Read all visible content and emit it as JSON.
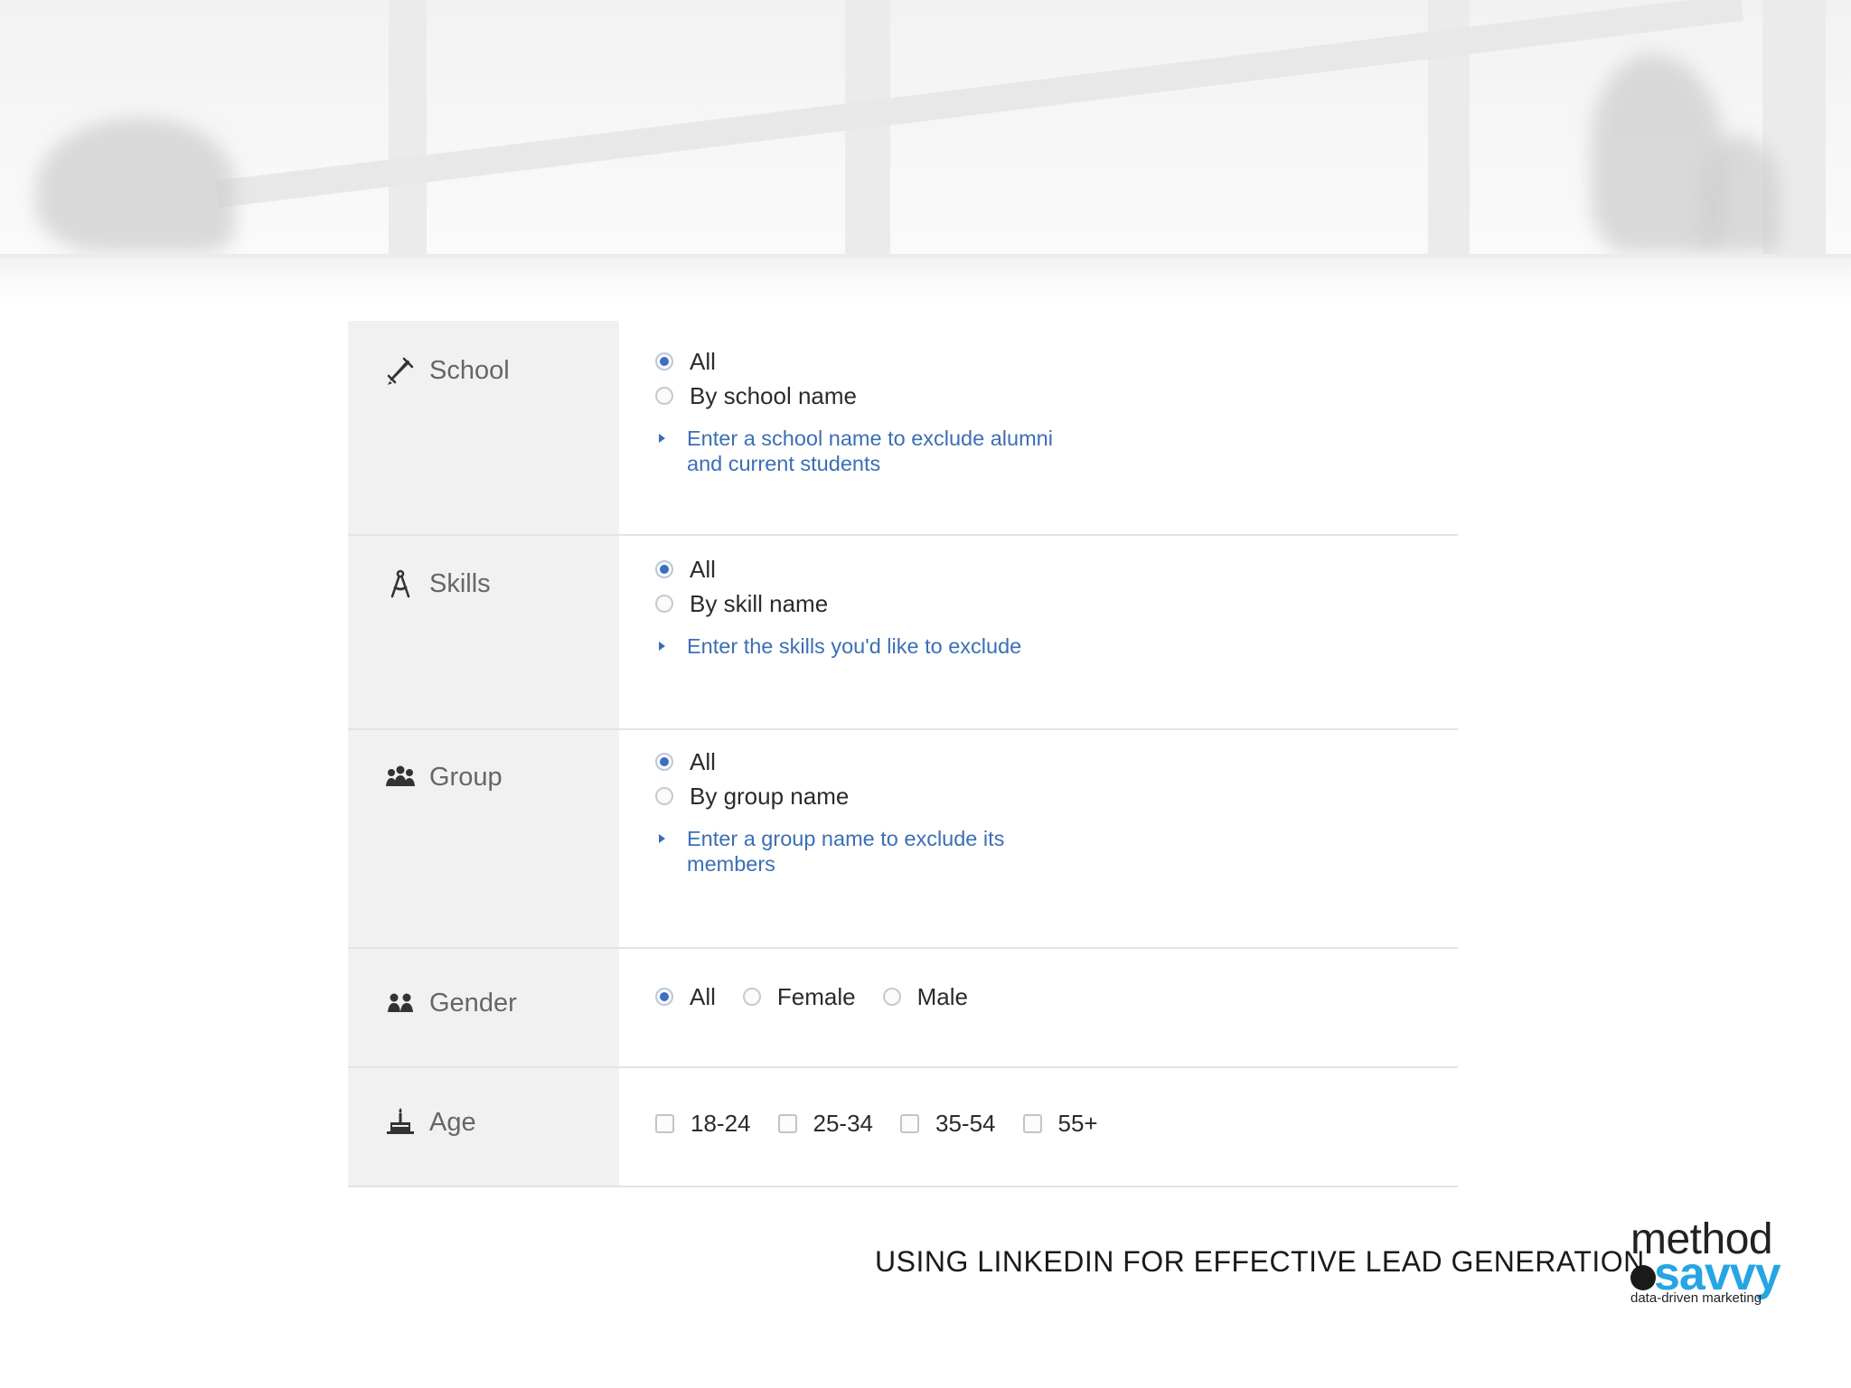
{
  "rows": {
    "school": {
      "label": "School",
      "icon": "diploma-icon",
      "options": [
        "All",
        "By school name"
      ],
      "selected": "All",
      "hint_lines": [
        "Enter a school name to exclude alumni",
        "and current students"
      ]
    },
    "skills": {
      "label": "Skills",
      "icon": "compass-icon",
      "options": [
        "All",
        "By skill name"
      ],
      "selected": "All",
      "hint_lines": [
        "Enter the skills you'd like to exclude"
      ]
    },
    "group": {
      "label": "Group",
      "icon": "group-icon",
      "options": [
        "All",
        "By group name"
      ],
      "selected": "All",
      "hint_lines": [
        "Enter a group name to exclude its",
        "members"
      ]
    },
    "gender": {
      "label": "Gender",
      "icon": "gender-icon",
      "options": [
        "All",
        "Female",
        "Male"
      ],
      "selected": "All"
    },
    "age": {
      "label": "Age",
      "icon": "cake-icon",
      "options": [
        "18-24",
        "25-34",
        "35-54",
        "55+"
      ]
    }
  },
  "footer": {
    "title": "USING LINKEDIN FOR EFFECTIVE LEAD GENERATION",
    "logo_word1": "method",
    "logo_word2": "savvy",
    "logo_tagline": "data-driven marketing"
  },
  "colors": {
    "accent_blue": "#3a6fb5",
    "label_bg": "#f1f1f1",
    "logo_blue": "#27a5e3"
  }
}
